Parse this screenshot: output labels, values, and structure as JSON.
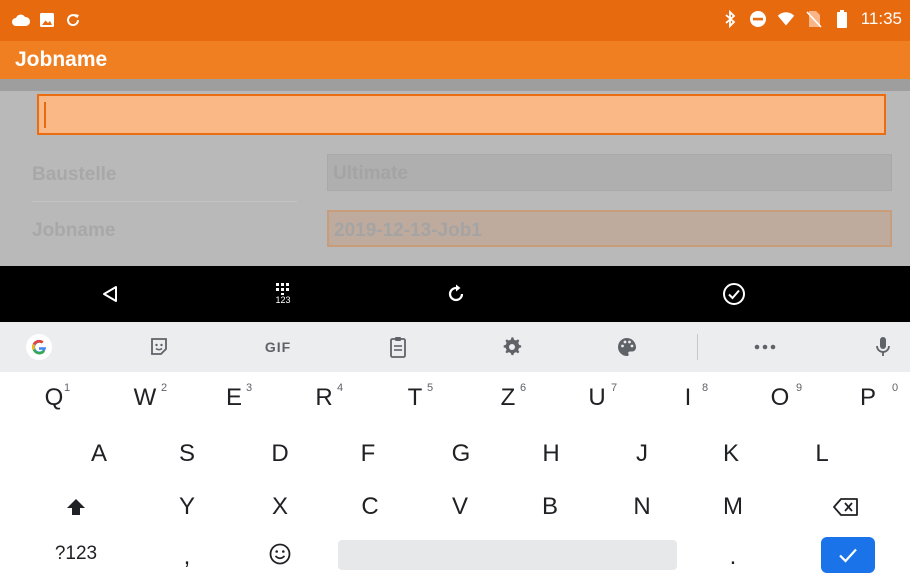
{
  "status_bar": {
    "time": "11:35",
    "left_icons": [
      "cloud-icon",
      "image-icon",
      "sync-icon"
    ],
    "right_icons": [
      "bluetooth-icon",
      "do-not-disturb-icon",
      "wifi-icon",
      "no-sim-icon",
      "battery-icon"
    ]
  },
  "app_bar": {
    "title": "Jobname"
  },
  "form": {
    "edit_field": {
      "value": "",
      "placeholder": ""
    },
    "rows": [
      {
        "label": "Baustelle",
        "value": "Ultimate"
      },
      {
        "label": "Jobname",
        "value": "2019-12-13-Job1"
      }
    ]
  },
  "nav_bar": {
    "buttons": [
      "back-icon",
      "keyboard-switch-icon",
      "rotate-icon",
      "done-icon"
    ],
    "keyboard_switch_label": "123"
  },
  "keyboard": {
    "toolbar": {
      "gif_label": "GIF",
      "icons": [
        "google-icon",
        "sticker-icon",
        "gif-icon",
        "clipboard-icon",
        "settings-icon",
        "theme-icon",
        "more-icon",
        "microphone-icon"
      ]
    },
    "row1": [
      {
        "key": "Q",
        "hint": "1"
      },
      {
        "key": "W",
        "hint": "2"
      },
      {
        "key": "E",
        "hint": "3"
      },
      {
        "key": "R",
        "hint": "4"
      },
      {
        "key": "T",
        "hint": "5"
      },
      {
        "key": "Z",
        "hint": "6"
      },
      {
        "key": "U",
        "hint": "7"
      },
      {
        "key": "I",
        "hint": "8"
      },
      {
        "key": "O",
        "hint": "9"
      },
      {
        "key": "P",
        "hint": "0"
      }
    ],
    "row2": [
      "A",
      "S",
      "D",
      "F",
      "G",
      "H",
      "J",
      "K",
      "L"
    ],
    "row3": [
      "Y",
      "X",
      "C",
      "V",
      "B",
      "N",
      "M"
    ],
    "symbols_label": "?123",
    "comma_label": ",",
    "period_label": ".",
    "colors": {
      "accent": "#1a73e8",
      "status_bar": "#e86a0e",
      "app_bar": "#f07f22"
    }
  }
}
